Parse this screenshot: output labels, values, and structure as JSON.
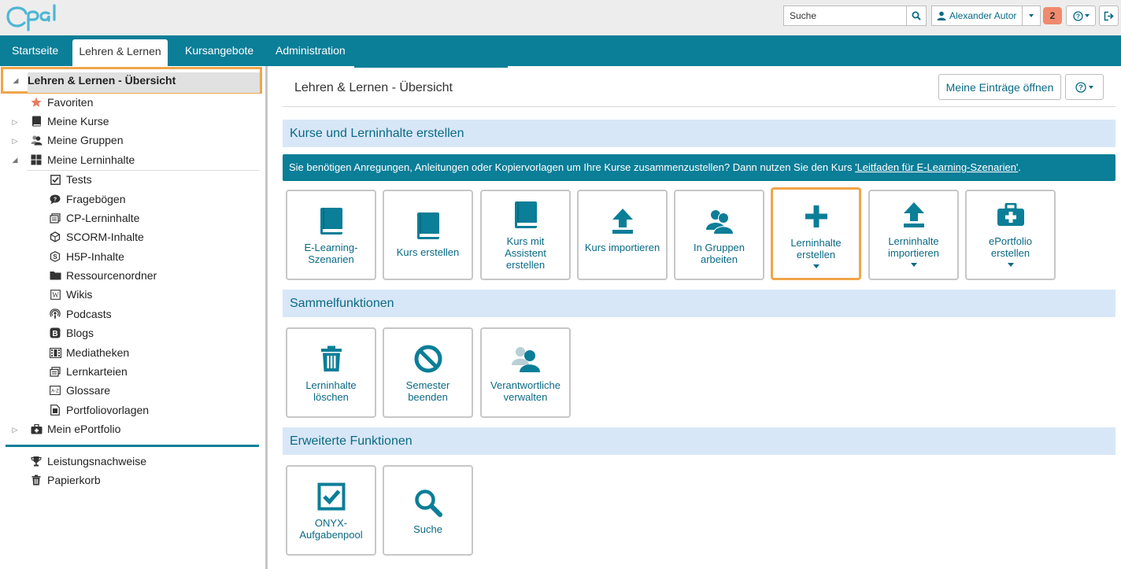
{
  "header": {
    "search_placeholder": "Suche",
    "user_name": "Alexander Autor",
    "notification_count": "2"
  },
  "nav": {
    "tabs": [
      {
        "label": "Startseite"
      },
      {
        "label": "Lehren & Lernen"
      },
      {
        "label": "Kursangebote"
      },
      {
        "label": "Administration"
      }
    ]
  },
  "sidebar": {
    "root": "Lehren & Lernen - Übersicht",
    "items": [
      {
        "label": "Favoriten"
      },
      {
        "label": "Meine Kurse"
      },
      {
        "label": "Meine Gruppen"
      },
      {
        "label": "Meine Lerninhalte"
      },
      {
        "label": "Tests"
      },
      {
        "label": "Fragebögen"
      },
      {
        "label": "CP-Lerninhalte"
      },
      {
        "label": "SCORM-Inhalte"
      },
      {
        "label": "H5P-Inhalte"
      },
      {
        "label": "Ressourcenordner"
      },
      {
        "label": "Wikis"
      },
      {
        "label": "Podcasts"
      },
      {
        "label": "Blogs"
      },
      {
        "label": "Mediatheken"
      },
      {
        "label": "Lernkarteien"
      },
      {
        "label": "Glossare"
      },
      {
        "label": "Portfoliovorlagen"
      },
      {
        "label": "Mein ePortfolio"
      },
      {
        "label": "Leistungsnachweise"
      },
      {
        "label": "Papierkorb"
      }
    ]
  },
  "main": {
    "title": "Lehren & Lernen - Übersicht",
    "entries_button": "Meine Einträge öffnen",
    "section1": {
      "title": "Kurse und Lerninhalte erstellen",
      "info_text": "Sie benötigen Anregungen, Anleitungen oder Kopiervorlagen um Ihre Kurse zusammenzustellen? Dann nutzen Sie den Kurs ",
      "info_link": "'Leitfaden für E-Learning-Szenarien'",
      "info_end": ".",
      "tiles": [
        {
          "label": "E-Learning-Szenarien"
        },
        {
          "label": "Kurs erstellen"
        },
        {
          "label": "Kurs mit Assistent erstellen"
        },
        {
          "label": "Kurs importieren"
        },
        {
          "label": "In Gruppen arbeiten"
        },
        {
          "label": "Lerninhalte erstellen"
        },
        {
          "label": "Lerninhalte importieren"
        },
        {
          "label": "ePortfolio erstellen"
        }
      ]
    },
    "section2": {
      "title": "Sammelfunktionen",
      "tiles": [
        {
          "label": "Lerninhalte löschen"
        },
        {
          "label": "Semester beenden"
        },
        {
          "label": "Verantwortliche verwalten"
        }
      ]
    },
    "section3": {
      "title": "Erweiterte Funktionen",
      "tiles": [
        {
          "label": "ONYX-Aufgabenpool"
        },
        {
          "label": "Suche"
        }
      ]
    }
  },
  "colors": {
    "primary": "#0b7e98",
    "link": "#0a6a85",
    "highlight": "#f0a54a",
    "section_bg": "#d8e7f7"
  }
}
